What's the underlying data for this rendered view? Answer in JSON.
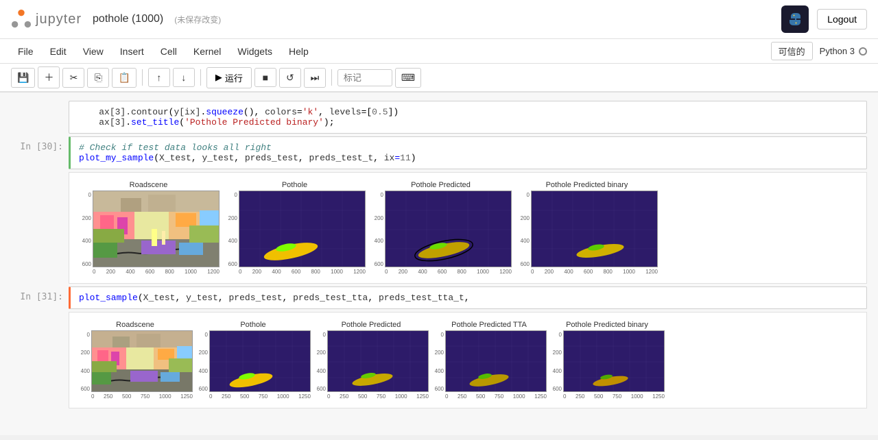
{
  "header": {
    "jupyter_label": "jupyter",
    "notebook_title": "pothole (1000)",
    "unsaved_label": "(未保存改变)",
    "logout_label": "Logout",
    "trusted_label": "可信的",
    "kernel_label": "Python 3"
  },
  "menubar": {
    "items": [
      "File",
      "Edit",
      "View",
      "Insert",
      "Cell",
      "Kernel",
      "Widgets",
      "Help"
    ]
  },
  "toolbar": {
    "run_label": "运行",
    "tag_placeholder": "标记"
  },
  "cells": {
    "partial_code": {
      "line1": "    ax[3].contour(y[ix].squeeze(), colors='k', levels=[0.5])",
      "line2": "    ax[3].set_title('Pothole Predicted binary');"
    },
    "cell_30": {
      "label": "In [30]:",
      "code_comment": "# Check if test data looks all right",
      "code_line": "plot_my_sample(X_test, y_test, preds_test, preds_test_t, ix=11)"
    },
    "cell_31": {
      "label": "In [31]:",
      "code_line": "plot_sample(X_test, y_test, preds_test, preds_test_tta, preds_test_tta_t,"
    }
  },
  "plots_30": {
    "titles": [
      "Roadscene",
      "Pothole",
      "Pothole Predicted",
      "Pothole Predicted binary"
    ],
    "axis_y": [
      "0",
      "200",
      "400",
      "600"
    ],
    "axis_x": [
      "0",
      "200",
      "400",
      "600",
      "800",
      "1000",
      "1200"
    ]
  },
  "plots_31": {
    "titles": [
      "Roadscene",
      "Pothole",
      "Pothole Predicted",
      "Pothole Predicted TTA",
      "Pothole Predicted binary"
    ],
    "axis_y": [
      "0",
      "200",
      "400",
      "600"
    ],
    "axis_x": [
      "0",
      "250",
      "500",
      "750",
      "1000",
      "1250"
    ]
  }
}
